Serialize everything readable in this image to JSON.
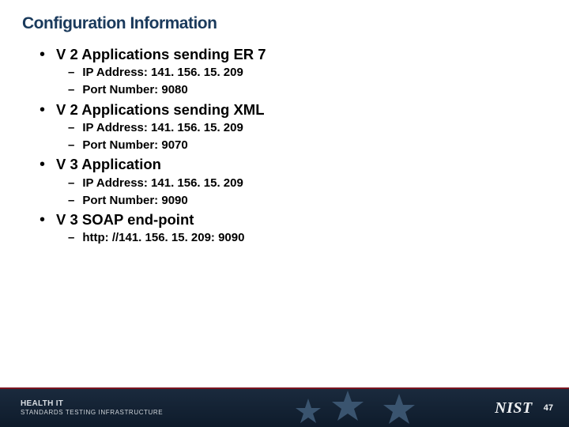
{
  "title": "Configuration Information",
  "sections": [
    {
      "heading": "V 2 Applications sending ER 7",
      "items": [
        "IP Address: 141. 156. 15. 209",
        "Port Number: 9080"
      ]
    },
    {
      "heading": "V 2 Applications sending XML",
      "items": [
        "IP Address: 141. 156. 15. 209",
        "Port Number: 9070"
      ]
    },
    {
      "heading": "V 3 Application",
      "items": [
        "IP Address: 141. 156. 15. 209",
        "Port Number: 9090"
      ]
    },
    {
      "heading": "V 3 SOAP end-point",
      "items": [
        "http: //141. 156. 15. 209: 9090"
      ]
    }
  ],
  "footer": {
    "brand_line1": "HEALTH IT",
    "brand_line2": "STANDARDS TESTING INFRASTRUCTURE",
    "logo": "NIST",
    "page": "47"
  }
}
